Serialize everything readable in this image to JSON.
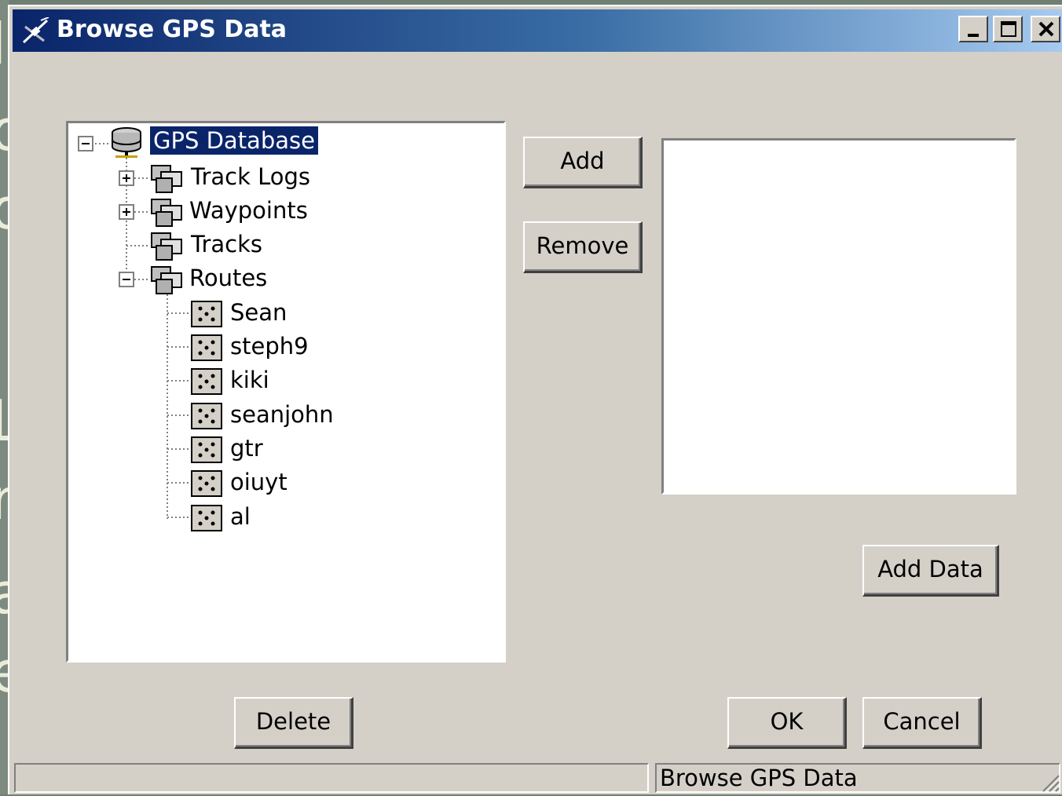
{
  "window": {
    "title": "Browse GPS Data",
    "controls": {
      "minimize_icon": "minimize-icon",
      "maximize_icon": "maximize-icon",
      "close_icon": "close-icon"
    }
  },
  "tree": {
    "root": {
      "label": "GPS Database",
      "icon": "database-icon",
      "expanded": true,
      "selected": true
    },
    "groups": [
      {
        "label": "Track Logs",
        "icon": "folder-layers-icon",
        "expander": "plus"
      },
      {
        "label": "Waypoints",
        "icon": "folder-layers-icon",
        "expander": "plus"
      },
      {
        "label": "Tracks",
        "icon": "folder-layers-icon",
        "expander": "none"
      },
      {
        "label": "Routes",
        "icon": "folder-layers-icon",
        "expander": "minus"
      }
    ],
    "routes": [
      "Sean",
      "steph9",
      "kiki",
      "seanjohn",
      "gtr",
      "oiuyt",
      "al"
    ]
  },
  "buttons": {
    "add": "Add",
    "remove": "Remove",
    "add_data": "Add Data",
    "delete": "Delete",
    "ok": "OK",
    "cancel": "Cancel"
  },
  "statusbar": {
    "left": "",
    "right": "Browse GPS Data"
  },
  "colors": {
    "title_start": "#0a246a",
    "title_end": "#a6caf0",
    "face": "#d4d0c8",
    "selection": "#0a246a"
  }
}
